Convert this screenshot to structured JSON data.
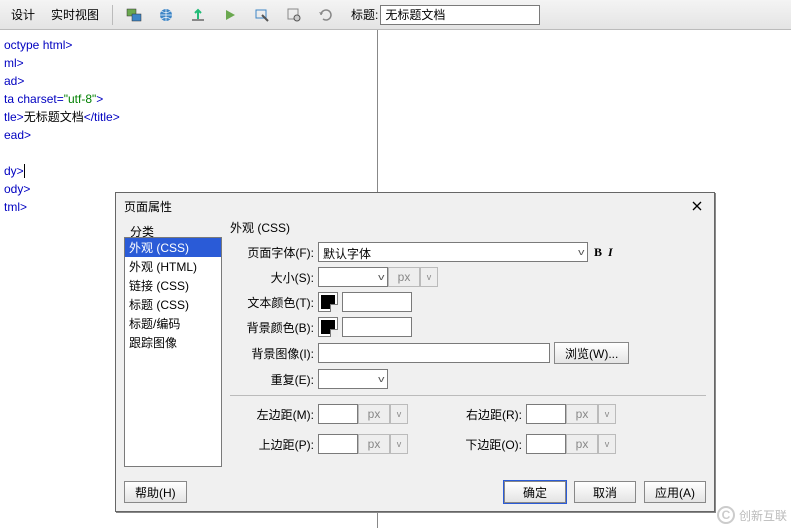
{
  "toolbar": {
    "design_label": "设计",
    "live_view_label": "实时视图",
    "title_label": "标题:",
    "title_value": "无标题文档"
  },
  "code": {
    "l1_a": "octype",
    "l1_b": " html>",
    "l2": "ml>",
    "l3": "ad>",
    "l4_a": "ta ",
    "l4_b": "charset",
    "l4_c": "=",
    "l4_d": "\"utf-8\"",
    "l4_e": ">",
    "l5_a": "tle>",
    "l5_b": "无标题文档",
    "l5_c": "</title>",
    "l6": "ead>",
    "l7": "dy>",
    "l8": "ody>",
    "l9": "tml>"
  },
  "dialog": {
    "title": "页面属性",
    "category_label": "分类",
    "categories": [
      "外观 (CSS)",
      "外观 (HTML)",
      "链接 (CSS)",
      "标题 (CSS)",
      "标题/编码",
      "跟踪图像"
    ],
    "selected_category": 0,
    "panel_title": "外观 (CSS)",
    "font_label": "页面字体(F):",
    "font_value": "默认字体",
    "size_label": "大小(S):",
    "size_unit": "px",
    "text_color_label": "文本颜色(T):",
    "bg_color_label": "背景颜色(B):",
    "bg_image_label": "背景图像(I):",
    "browse_label": "浏览(W)...",
    "repeat_label": "重复(E):",
    "margin_left_label": "左边距(M):",
    "margin_right_label": "右边距(R):",
    "margin_top_label": "上边距(P):",
    "margin_bottom_label": "下边距(O):",
    "margin_unit": "px",
    "help_label": "帮助(H)",
    "ok_label": "确定",
    "cancel_label": "取消",
    "apply_label": "应用(A)"
  },
  "watermark": {
    "brand": "创新互联"
  }
}
